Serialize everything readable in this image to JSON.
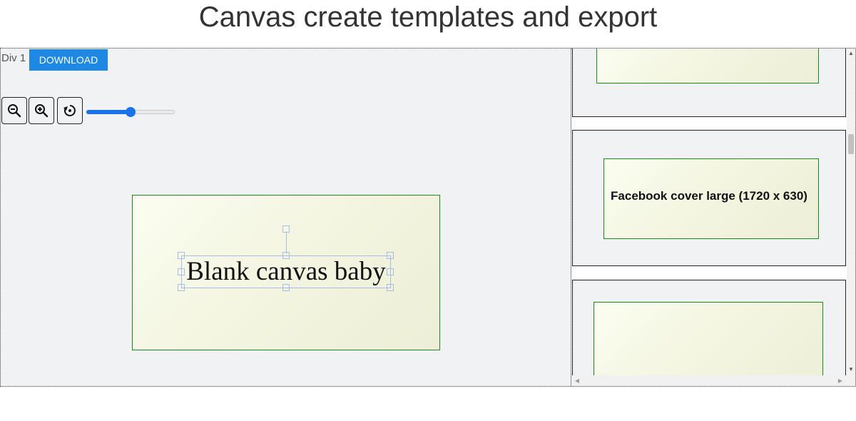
{
  "page": {
    "title": "Canvas create templates and export"
  },
  "editor": {
    "div_label": "Div 1",
    "download_label": "DOWNLOAD",
    "zoom_slider": {
      "value_fraction": 0.5
    },
    "canvas_text": "Blank canvas baby"
  },
  "sidebar": {
    "templates": [
      {
        "label": ""
      },
      {
        "label": "Facebook cover large (1720 x 630)"
      },
      {
        "label": ""
      }
    ]
  },
  "icons": {
    "zoom_out": "zoom-out-icon",
    "zoom_in": "zoom-in-icon",
    "reset": "reset-rotate-icon"
  },
  "colors": {
    "accent": "#1e88e5",
    "canvas_border": "#1a8a1a",
    "selection": "#a8bde6"
  }
}
